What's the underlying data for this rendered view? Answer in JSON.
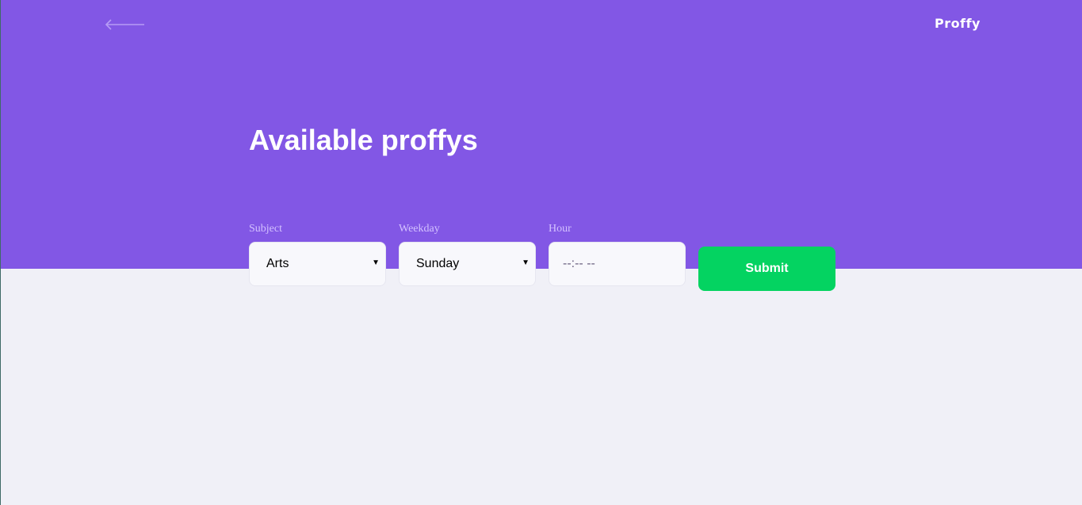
{
  "header": {
    "logo_text": "Proffy",
    "back_icon": "arrow-left-icon"
  },
  "main": {
    "title": "Available proffys"
  },
  "filters": {
    "subject": {
      "label": "Subject",
      "value": "Arts"
    },
    "weekday": {
      "label": "Weekday",
      "value": "Sunday"
    },
    "hour": {
      "label": "Hour",
      "placeholder": "--:-- --"
    },
    "submit_label": "Submit"
  },
  "colors": {
    "primary": "#8257e5",
    "submit": "#04d361",
    "background": "#f0f0f7",
    "label": "#d4c2ff"
  }
}
